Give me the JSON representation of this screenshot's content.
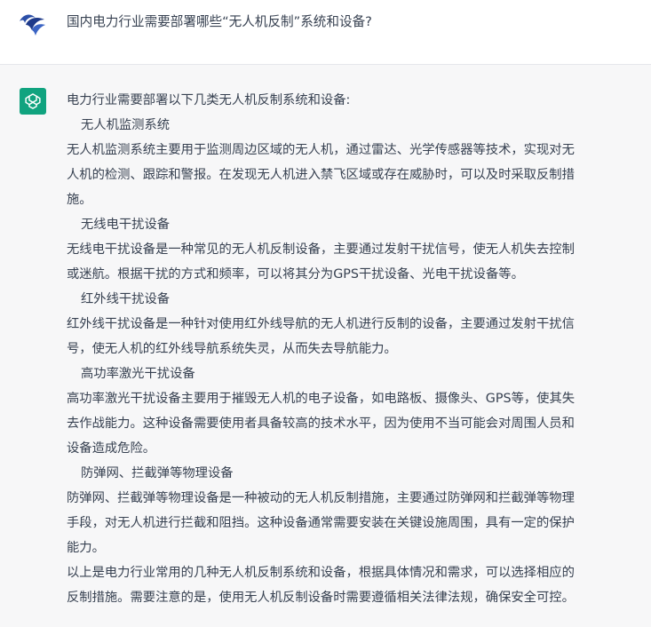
{
  "user": {
    "question": "国内电力行业需要部署哪些“无人机反制”系统和设备?"
  },
  "assistant": {
    "intro": "电力行业需要部署以下几类无人机反制系统和设备:",
    "sections": [
      {
        "heading": "无人机监测系统",
        "lines": [
          "无人机监测系统主要用于监测周边区域的无人机，通过雷达、光学传感器等技术，实现对无",
          "人机的检测、跟踪和警报。在发现无人机进入禁飞区域或存在威胁时，可以及时采取反制措",
          "施。"
        ]
      },
      {
        "heading": "无线电干扰设备",
        "lines": [
          "无线电干扰设备是一种常见的无人机反制设备，主要通过发射干扰信号，使无人机失去控制",
          "或迷航。根据干扰的方式和频率，可以将其分为GPS干扰设备、光电干扰设备等。"
        ]
      },
      {
        "heading": "红外线干扰设备",
        "lines": [
          "红外线干扰设备是一种针对使用红外线导航的无人机进行反制的设备，主要通过发射干扰信",
          "号，使无人机的红外线导航系统失灵，从而失去导航能力。"
        ]
      },
      {
        "heading": "高功率激光干扰设备",
        "lines": [
          "高功率激光干扰设备主要用于摧毁无人机的电子设备，如电路板、摄像头、GPS等，使其失",
          "去作战能力。这种设备需要使用者具备较高的技术水平，因为使用不当可能会对周围人员和",
          "设备造成危险。"
        ]
      },
      {
        "heading": "防弹网、拦截弹等物理设备",
        "lines": [
          "防弹网、拦截弹等物理设备是一种被动的无人机反制措施，主要通过防弹网和拦截弹等物理",
          "手段，对无人机进行拦截和阻挡。这种设备通常需要安装在关键设施周围，具有一定的保护",
          "能力。"
        ]
      }
    ],
    "conclusion": [
      "以上是电力行业常用的几种无人机反制系统和设备，根据具体情况和需求，可以选择相应的",
      "反制措施。需要注意的是，使用无人机反制设备时需要遵循相关法律法规，确保安全可控。"
    ]
  },
  "colors": {
    "assistant_bg": "#f7f7f8",
    "bot_avatar": "#10a37f",
    "user_avatar": "#2b4fa8",
    "text": "#374151"
  },
  "icons": {
    "user_avatar": "bird-logo-icon",
    "bot_avatar": "openai-logo-icon"
  }
}
